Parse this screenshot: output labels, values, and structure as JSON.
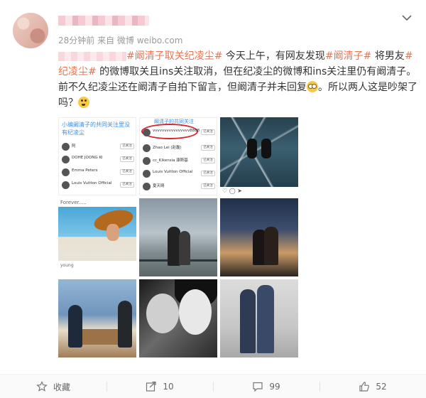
{
  "post": {
    "meta": "28分钟前 来自 微博 weibo.com",
    "topic": "#阚清子取关纪凌尘#",
    "text_1": " 今天上午，有网友发现",
    "hash_1": "#阚清子#",
    "text_2": " 将男友",
    "hash_2": "#纪凌尘#",
    "text_3": " 的微博取关且ins关注取消，但在纪凌尘的微博和ins关注里仍有阚清子。前不久纪凌尘还在阚清子自拍下留言，但阚清子并未回复",
    "text_4": "。所以两人这是吵架了吗？"
  },
  "screenshot1": {
    "caption": "小编阚清子的共同关注里没有纪凌尘",
    "rows": [
      {
        "name": "阿",
        "button": "已关注"
      },
      {
        "name": "DOHE JOONG KI",
        "button": "已关注"
      },
      {
        "name": "Emma Peters",
        "button": "已关注"
      },
      {
        "name": "Louis Vuitton Official",
        "button": "已关注"
      }
    ]
  },
  "screenshot2": {
    "caption": "阚清子的共同关注",
    "rows": [
      {
        "name": "vvvvvvvvvvvvvvvv8888",
        "button": "已关注"
      },
      {
        "name": "Zhao Lei (赵磊)",
        "button": "已关注"
      },
      {
        "name": "cc_Kikensia 康斯基",
        "button": "已关注"
      },
      {
        "name": "Louis Vuitton Official",
        "button": "已关注"
      },
      {
        "name": "夏天晴",
        "button": "已关注"
      }
    ]
  },
  "screenshot4": {
    "top": "Forever.....",
    "bottom": "young"
  },
  "footer": {
    "collect_label": "收藏",
    "share_count": "10",
    "comment_count": "99",
    "like_count": "52"
  }
}
